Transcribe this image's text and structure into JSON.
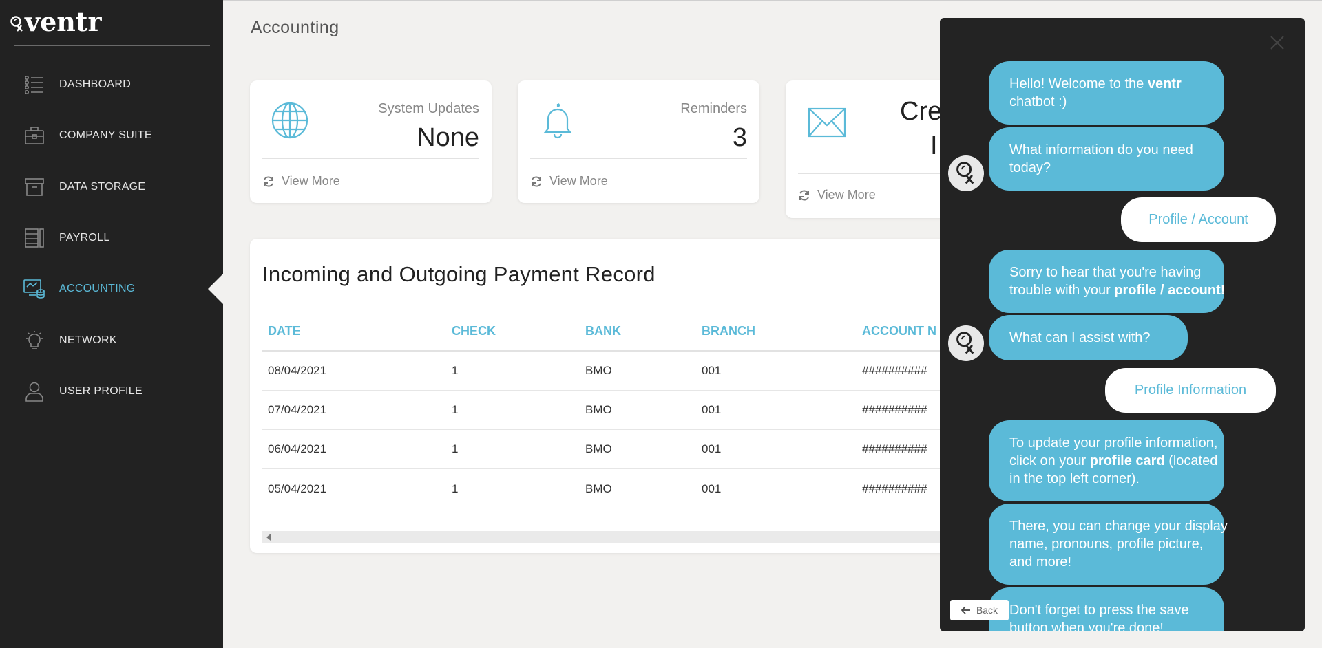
{
  "app": {
    "logo_text": "ventr"
  },
  "sidebar": {
    "items": [
      {
        "label": "DASHBOARD",
        "icon": "list-icon",
        "active": false
      },
      {
        "label": "COMPANY SUITE",
        "icon": "briefcase-icon",
        "active": false
      },
      {
        "label": "DATA STORAGE",
        "icon": "archive-box-icon",
        "active": false
      },
      {
        "label": "PAYROLL",
        "icon": "payroll-icon",
        "active": false
      },
      {
        "label": "ACCOUNTING",
        "icon": "accounting-icon",
        "active": true
      },
      {
        "label": "NETWORK",
        "icon": "lightbulb-icon",
        "active": false
      },
      {
        "label": "USER PROFILE",
        "icon": "user-icon",
        "active": false
      }
    ]
  },
  "header": {
    "title": "Accounting"
  },
  "cards": [
    {
      "label": "System Updates",
      "value": "None",
      "icon": "globe-icon",
      "view_more": "View More"
    },
    {
      "label": "Reminders",
      "value": "3",
      "icon": "bell-icon",
      "view_more": "View More"
    },
    {
      "label": "Cre",
      "value": "I",
      "icon": "envelope-icon",
      "view_more": "View More"
    }
  ],
  "payments": {
    "title": "Incoming and Outgoing Payment Record",
    "columns": [
      "DATE",
      "CHECK",
      "BANK",
      "BRANCH",
      "ACCOUNT N"
    ],
    "rows": [
      [
        "08/04/2021",
        "1",
        "BMO",
        "001",
        "##########"
      ],
      [
        "07/04/2021",
        "1",
        "BMO",
        "001",
        "##########"
      ],
      [
        "06/04/2021",
        "1",
        "BMO",
        "001",
        "##########"
      ],
      [
        "05/04/2021",
        "1",
        "BMO",
        "001",
        "##########"
      ]
    ]
  },
  "chat": {
    "bot_messages": {
      "welcome_1": "Hello! Welcome to the ",
      "welcome_brand": "ventr",
      "welcome_2": "chatbot :)",
      "ask_1": "What information do you need",
      "ask_2": "today?",
      "sorry_1": "Sorry to hear that you're having",
      "sorry_2": "trouble with your ",
      "sorry_bold": "profile / account!",
      "assist": "What can I assist with?",
      "update_1": "To update your profile information,",
      "update_2": "click on your ",
      "update_bold": "profile card",
      "update_2b": " (located",
      "update_3": "in the top left corner).",
      "there_1": "There, you can change your display",
      "there_2": "name, pronouns, profile picture,",
      "there_3": "and more!",
      "save_1": "Don't forget to press the save",
      "save_2": "button when you're done!"
    },
    "user_messages": {
      "first": "Profile / Account",
      "second": "Profile Information"
    },
    "back_label": "Back"
  },
  "colors": {
    "accent": "#5bbad8",
    "sidebar_bg": "#222222",
    "page_bg": "#f2f1ef"
  }
}
